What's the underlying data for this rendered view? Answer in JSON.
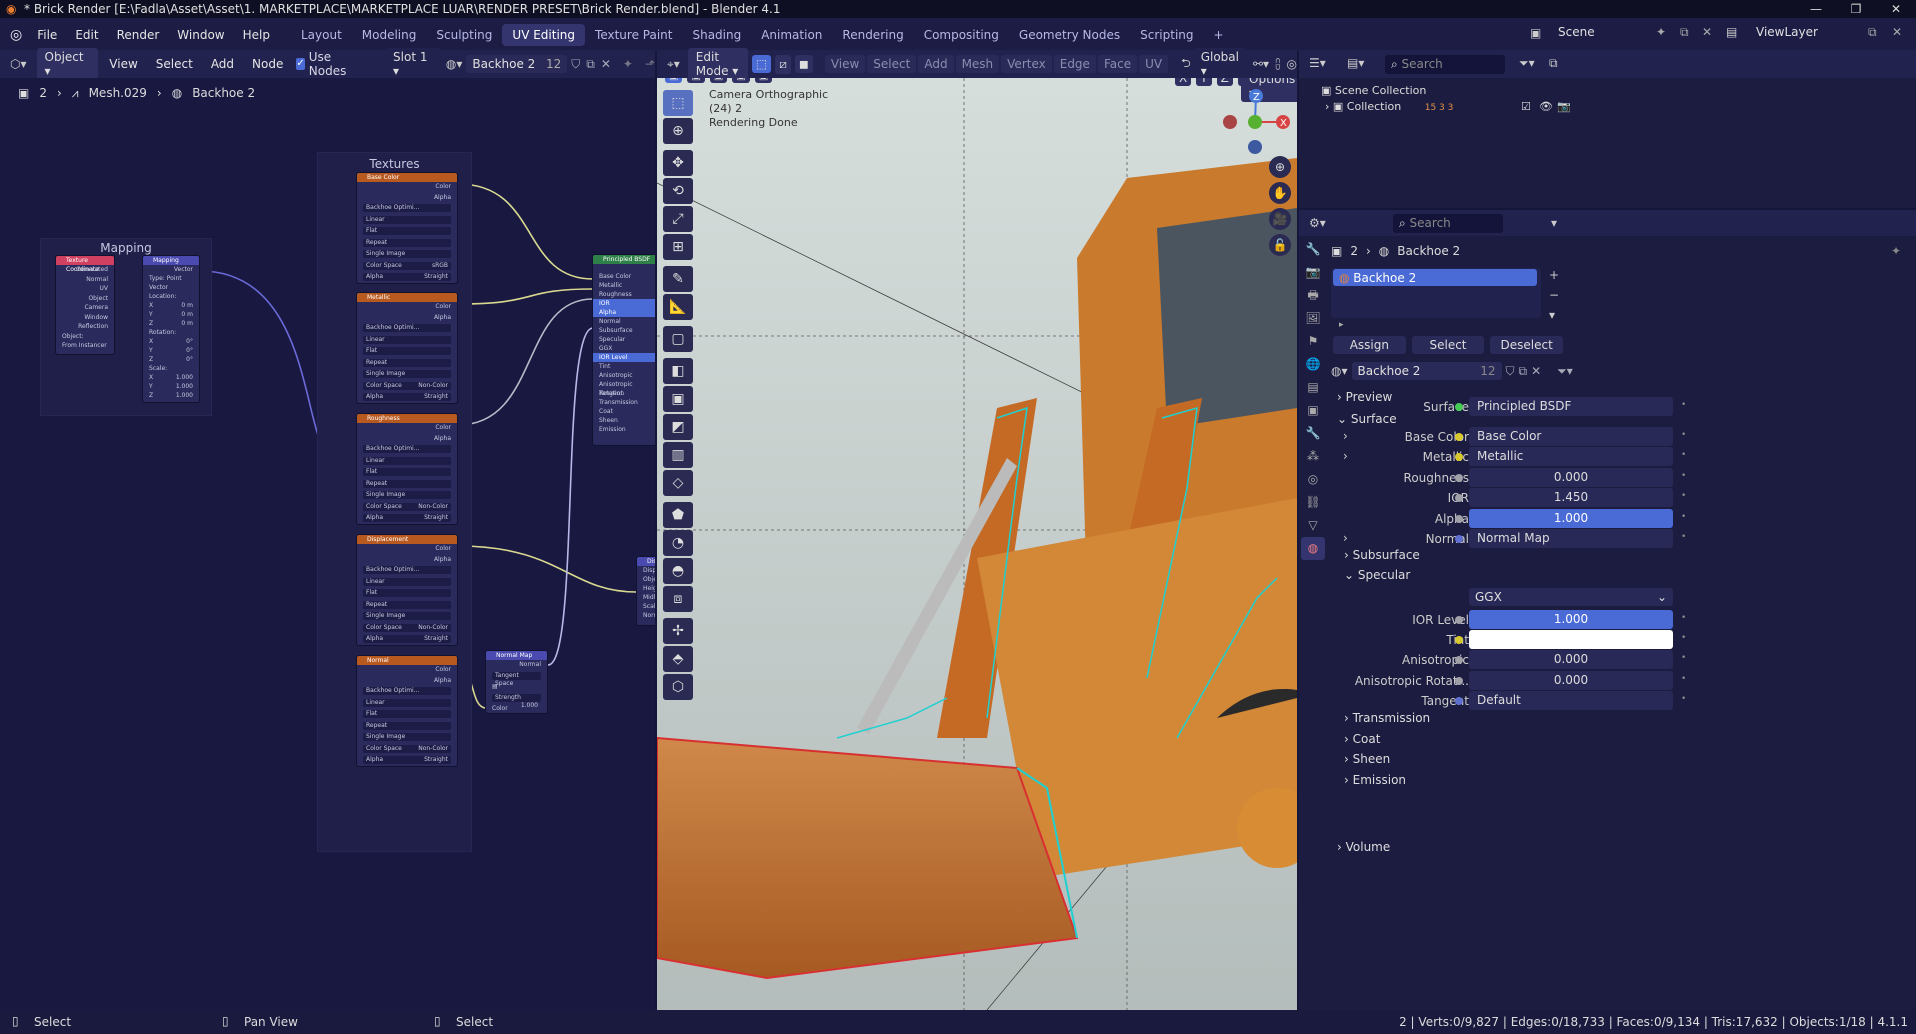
{
  "titlebar": {
    "title": "* Brick Render [E:\\Fadla\\Asset\\Asset\\1. MARKETPLACE\\MARKETPLACE LUAR\\RENDER PRESET\\Brick Render.blend] - Blender 4.1"
  },
  "menu": [
    "File",
    "Edit",
    "Render",
    "Window",
    "Help"
  ],
  "workspaces": [
    "Layout",
    "Modeling",
    "Sculpting",
    "UV Editing",
    "Texture Paint",
    "Shading",
    "Animation",
    "Rendering",
    "Compositing",
    "Geometry Nodes",
    "Scripting"
  ],
  "active_workspace": "UV Editing",
  "scene": "Scene",
  "view_layer": "ViewLayer",
  "node_header": {
    "mode": "Object",
    "menus": [
      "View",
      "Select",
      "Add",
      "Node"
    ],
    "use_nodes": "Use Nodes",
    "slot": "Slot 1",
    "material": "Backhoe 2",
    "users": "12"
  },
  "breadcrumb": {
    "count": "2",
    "mesh": "Mesh.029",
    "material": "Backhoe 2"
  },
  "nodes": {
    "mapping_frame": "Mapping",
    "textures_frame": "Textures",
    "texcoord": {
      "title": "Texture Coordinate",
      "outputs": [
        "Generated",
        "Normal",
        "UV",
        "Object",
        "Camera",
        "Window",
        "Reflection"
      ],
      "object": "Object:",
      "from_instancer": "From Instancer"
    },
    "mapping": {
      "title": "Mapping",
      "out": "Vector",
      "type": "Type:",
      "type_val": "Point",
      "vector": "Vector",
      "location": "Location:",
      "loc": [
        [
          "X",
          "0 m"
        ],
        [
          "Y",
          "0 m"
        ],
        [
          "Z",
          "0 m"
        ]
      ],
      "rotation": "Rotation:",
      "rot": [
        [
          "X",
          "0°"
        ],
        [
          "Y",
          "0°"
        ],
        [
          "Z",
          "0°"
        ]
      ],
      "scale": "Scale:",
      "sca": [
        [
          "X",
          "1.000"
        ],
        [
          "Y",
          "1.000"
        ],
        [
          "Z",
          "1.000"
        ]
      ]
    },
    "tex_nodes": [
      {
        "title": "Base Color",
        "image": "Backhoe Optimi...",
        "interp": "Linear",
        "proj": "Flat",
        "ext": "Repeat",
        "src": "Single Image",
        "cs_label": "Color Space",
        "cs": "sRGB",
        "alpha_label": "Alpha",
        "alpha": "Straight"
      },
      {
        "title": "Metallic",
        "image": "Backhoe Optimi...",
        "interp": "Linear",
        "proj": "Flat",
        "ext": "Repeat",
        "src": "Single Image",
        "cs_label": "Color Space",
        "cs": "Non-Color",
        "alpha_label": "Alpha",
        "alpha": "Straight"
      },
      {
        "title": "Roughness",
        "image": "Backhoe Optimi...",
        "interp": "Linear",
        "proj": "Flat",
        "ext": "Repeat",
        "src": "Single Image",
        "cs_label": "Color Space",
        "cs": "Non-Color",
        "alpha_label": "Alpha",
        "alpha": "Straight"
      },
      {
        "title": "Displacement",
        "image": "Backhoe Optimi...",
        "interp": "Linear",
        "proj": "Flat",
        "ext": "Repeat",
        "src": "Single Image",
        "cs_label": "Color Space",
        "cs": "Non-Color",
        "alpha_label": "Alpha",
        "alpha": "Straight"
      },
      {
        "title": "Normal",
        "image": "Backhoe Optimi...",
        "interp": "Linear",
        "proj": "Flat",
        "ext": "Repeat",
        "src": "Single Image",
        "cs_label": "Color Space",
        "cs": "Non-Color",
        "alpha_label": "Alpha",
        "alpha": "Straight"
      }
    ],
    "tex_out": [
      "Color",
      "Alpha"
    ],
    "tex_in": "Vector",
    "bsdf": {
      "title": "Principled BSDF",
      "rows": [
        "Base Color",
        "Metallic",
        "Roughness",
        "IOR",
        "Alpha",
        "Normal",
        "Subsurface",
        "Specular",
        "GGX",
        "IOR Level",
        "Tint",
        "Anisotropic",
        "Anisotropic Rotation",
        "Tangent",
        "Transmission",
        "Coat",
        "Sheen",
        "Emission"
      ]
    },
    "normalmap": {
      "title": "Normal Map",
      "out": "Normal",
      "space": "Tangent Space",
      "strength": "Strength",
      "strength_val": "1.000",
      "color": "Color"
    },
    "displacement": {
      "title": "Dis",
      "rows": [
        "Displ",
        "Obje",
        "Height",
        "Midl",
        "Scal",
        "Normal"
      ]
    }
  },
  "viewport_header": {
    "mode": "Edit Mode",
    "menus": [
      "View",
      "Select",
      "Add",
      "Mesh",
      "Vertex",
      "Edge",
      "Face",
      "UV"
    ],
    "orientation": "Global",
    "options": "Options",
    "axes": [
      "X",
      "Y",
      "Z"
    ]
  },
  "viewport_overlay": {
    "line1": "Camera Orthographic",
    "line2": "(24) 2",
    "line3": "Rendering Done"
  },
  "outliner": {
    "search": "Search",
    "root": "Scene Collection",
    "collection": "Collection",
    "badges": "15 3 3"
  },
  "properties": {
    "search": "Search",
    "breadcrumb_count": "2",
    "breadcrumb_mat": "Backhoe 2",
    "slot_name": "Backhoe 2",
    "assign": "Assign",
    "select": "Select",
    "deselect": "Deselect",
    "material": "Backhoe 2",
    "users": "12",
    "sections": {
      "preview": "Preview",
      "surface": "Surface",
      "volume": "Volume"
    },
    "rows": [
      {
        "label": "Surface",
        "value": "Principled BSDF",
        "dot": "#44cc55",
        "kind": "plain"
      },
      {
        "label": "Base Color",
        "value": "Base Color",
        "dot": "#d8c830",
        "kind": "plain",
        "exp": true
      },
      {
        "label": "Metallic",
        "value": "Metallic",
        "dot": "#d8c830",
        "kind": "plain",
        "exp": true
      },
      {
        "label": "Roughness",
        "value": "0.000",
        "dot": "#a0a0a8",
        "kind": "dark"
      },
      {
        "label": "IOR",
        "value": "1.450",
        "dot": "#a0a0a8",
        "kind": "dark"
      },
      {
        "label": "Alpha",
        "value": "1.000",
        "dot": "#a0a0a8",
        "kind": "blue"
      },
      {
        "label": "Normal",
        "value": "Normal Map",
        "dot": "#6070d0",
        "kind": "plain",
        "exp": true
      }
    ],
    "subsections": [
      "Subsurface",
      "Specular"
    ],
    "spec_dist": "GGX",
    "spec_rows": [
      {
        "label": "IOR Level",
        "value": "1.000",
        "dot": "#a0a0a8",
        "kind": "blue"
      },
      {
        "label": "Tint",
        "value": "",
        "dot": "#d8c830",
        "kind": "white"
      },
      {
        "label": "Anisotropic",
        "value": "0.000",
        "dot": "#a0a0a8",
        "kind": "dark"
      },
      {
        "label": "Anisotropic Rotat...",
        "value": "0.000",
        "dot": "#a0a0a8",
        "kind": "dark"
      },
      {
        "label": "Tangent",
        "value": "Default",
        "dot": "#6070d0",
        "kind": "plain"
      }
    ],
    "collapsed": [
      "Transmission",
      "Coat",
      "Sheen",
      "Emission"
    ]
  },
  "statusbar": {
    "select": "Select",
    "pan": "Pan View",
    "select2": "Select",
    "stats": "2 | Verts:0/9,827 | Edges:0/18,733 | Faces:0/9,134 | Tris:17,632 | Objects:1/18 | 4.1.1"
  }
}
